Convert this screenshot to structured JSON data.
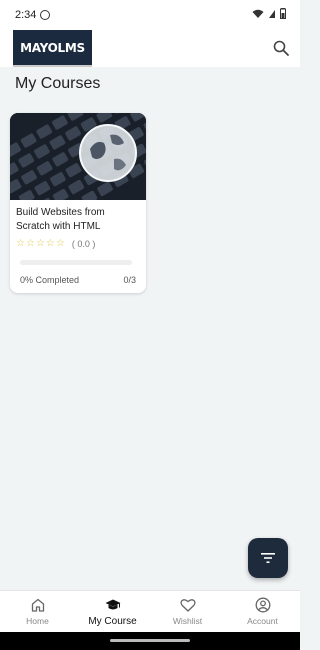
{
  "status_bar": {
    "time": "2:34"
  },
  "header": {
    "logo_text": "MAYOLMS",
    "search_icon": "search-icon"
  },
  "page": {
    "title": "My Courses"
  },
  "courses": [
    {
      "title": "Build Websites from Scratch with HTML",
      "rating_text": "( 0.0 )",
      "stars_filled": 0,
      "stars_total": 5,
      "progress_label": "0% Completed",
      "progress_fraction": 0,
      "lesson_count": "0/3"
    }
  ],
  "fab": {
    "icon": "filter-icon"
  },
  "bottom_nav": {
    "items": [
      {
        "label": "Home",
        "icon": "home-icon"
      },
      {
        "label": "My Course",
        "icon": "graduation-cap-icon",
        "active": true
      },
      {
        "label": "Wishlist",
        "icon": "heart-icon"
      },
      {
        "label": "Account",
        "icon": "user-circle-icon"
      }
    ]
  },
  "colors": {
    "brand": "#1b2a3f",
    "star": "#e0c64a",
    "background": "#f1f4f5"
  }
}
